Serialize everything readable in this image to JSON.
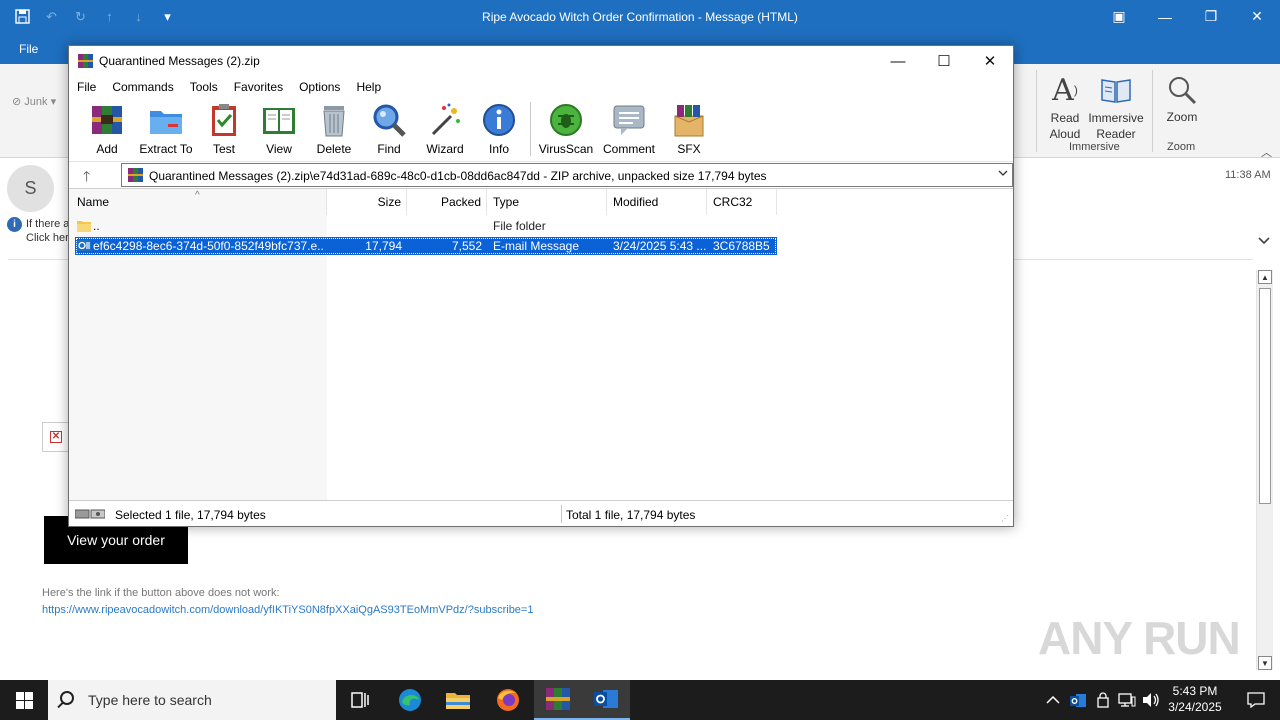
{
  "outlook": {
    "window_title": "Ripe Avocado Witch Order Confirmation  -  Message (HTML)",
    "file_tab": "File",
    "junk_label": "Junk",
    "ribbon": {
      "read_aloud": "Read Aloud",
      "immersive_reader": "Immersive Reader",
      "zoom": "Zoom",
      "group_immersive": "Immersive",
      "group_zoom": "Zoom"
    },
    "sender_initial": "S",
    "info_line1": "If there a",
    "info_line2": "Click her",
    "received_time": "11:38 AM",
    "view_order_button": "View your order",
    "link_hint": "Here's the link if the button above does not work:",
    "link_url": "https://www.ripeavocadowitch.com/download/yfIKTiYS0N8fpXXaiQgAS93TEoMmVPdz/?subscribe=1",
    "watermark": "ANY RUN"
  },
  "winrar": {
    "title": "Quarantined Messages (2).zip",
    "menu": [
      "File",
      "Commands",
      "Tools",
      "Favorites",
      "Options",
      "Help"
    ],
    "tools": {
      "add": "Add",
      "extract": "Extract To",
      "test": "Test",
      "view": "View",
      "delete": "Delete",
      "find": "Find",
      "wizard": "Wizard",
      "info": "Info",
      "virusscan": "VirusScan",
      "comment": "Comment",
      "sfx": "SFX"
    },
    "path": "Quarantined Messages (2).zip\\e74d31ad-689c-48c0-d1cb-08dd6ac847dd - ZIP archive, unpacked size 17,794 bytes",
    "columns": {
      "name": "Name",
      "size": "Size",
      "packed": "Packed",
      "type": "Type",
      "modified": "Modified",
      "crc": "CRC32"
    },
    "rows": [
      {
        "name": "..",
        "size": "",
        "packed": "",
        "type": "File folder",
        "modified": "",
        "crc": ""
      },
      {
        "name": "ef6c4298-8ec6-374d-50f0-852f49bfc737.e...",
        "size": "17,794",
        "packed": "7,552",
        "type": "E-mail Message",
        "modified": "3/24/2025 5:43 ...",
        "crc": "3C6788B5"
      }
    ],
    "status_left": "Selected 1 file, 17,794 bytes",
    "status_right": "Total 1 file, 17,794 bytes"
  },
  "taskbar": {
    "search_placeholder": "Type here to search",
    "time": "5:43 PM",
    "date": "3/24/2025"
  },
  "colors": {
    "outlook_blue": "#1e6fbf",
    "selection_blue": "#0a62d6",
    "taskbar": "#1c1c1c"
  }
}
